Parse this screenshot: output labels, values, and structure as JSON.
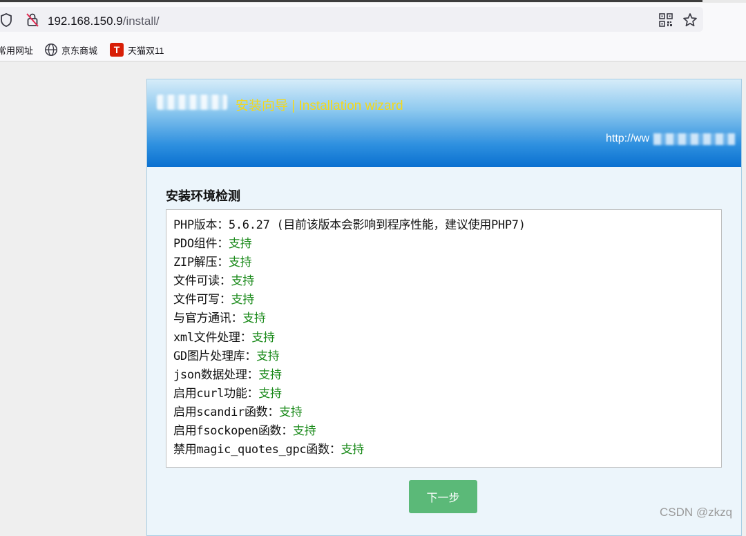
{
  "browser": {
    "url_host": "192.168.150.9",
    "url_path": "/install/",
    "bookmarks": [
      {
        "label": "常用网址",
        "icon": "folder-icon"
      },
      {
        "label": "京东商城",
        "icon": "globe-icon"
      },
      {
        "label": "天猫双11",
        "icon": "tmall-icon",
        "icon_text": "T"
      }
    ]
  },
  "header": {
    "title": "安装向导 | Installation wizard",
    "site_url": "http://ww"
  },
  "section": {
    "title": "安装环境检测"
  },
  "checks": [
    {
      "label": "PHP版本：",
      "value": "5.6.27 (目前该版本会影响到程序性能，建议使用PHP7)",
      "ok": false
    },
    {
      "label": "PDO组件：",
      "value": "支持",
      "ok": true
    },
    {
      "label": "ZIP解压：",
      "value": "支持",
      "ok": true
    },
    {
      "label": "文件可读：",
      "value": "支持",
      "ok": true
    },
    {
      "label": "文件可写：",
      "value": "支持",
      "ok": true
    },
    {
      "label": "与官方通讯：",
      "value": "支持",
      "ok": true
    },
    {
      "label": "xml文件处理：",
      "value": "支持",
      "ok": true
    },
    {
      "label": "GD图片处理库：",
      "value": "支持",
      "ok": true
    },
    {
      "label": "json数据处理：",
      "value": "支持",
      "ok": true
    },
    {
      "label": "启用curl功能：",
      "value": "支持",
      "ok": true
    },
    {
      "label": "启用scandir函数：",
      "value": "支持",
      "ok": true
    },
    {
      "label": "启用fsockopen函数：",
      "value": "支持",
      "ok": true
    },
    {
      "label": "禁用magic_quotes_gpc函数：",
      "value": "支持",
      "ok": true
    }
  ],
  "actions": {
    "next_label": "下一步"
  },
  "watermark": "CSDN @zkzq",
  "colors": {
    "ok": "#1a8a1a",
    "title": "#f4d81a",
    "button": "#5bb978"
  }
}
